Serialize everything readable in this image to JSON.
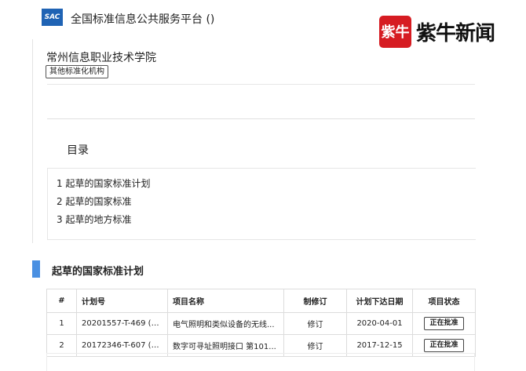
{
  "header": {
    "logo_text": "SAC",
    "site_title": "全国标准信息公共服务平台 ()"
  },
  "watermark": {
    "badge_text": "紫牛",
    "brand_text": "紫牛新闻",
    "badge_color": "#d61c22"
  },
  "org": {
    "name": "常州信息职业技术学院",
    "tag": "其他标准化机构"
  },
  "toc": {
    "title": "目录",
    "items": [
      "1  起草的国家标准计划",
      "2  起草的国家标准",
      "3  起草的地方标准"
    ]
  },
  "section": {
    "title": "起草的国家标准计划",
    "accent_color": "#4a90e2"
  },
  "table": {
    "headers": [
      "#",
      "计划号",
      "项目名称",
      "制修订",
      "计划下达日期",
      "项目状态"
    ],
    "rows": [
      {
        "num": "1",
        "plan_no": "20201557-T-469 (ht...",
        "name": "电气照明和类似设备的无线...",
        "type": "修订",
        "date": "2020-04-01",
        "status": "正在批准"
      },
      {
        "num": "2",
        "plan_no": "20172346-T-607 (ht...",
        "name": "数字可寻址照明接口 第101...",
        "type": "修订",
        "date": "2017-12-15",
        "status": "正在批准"
      }
    ]
  }
}
